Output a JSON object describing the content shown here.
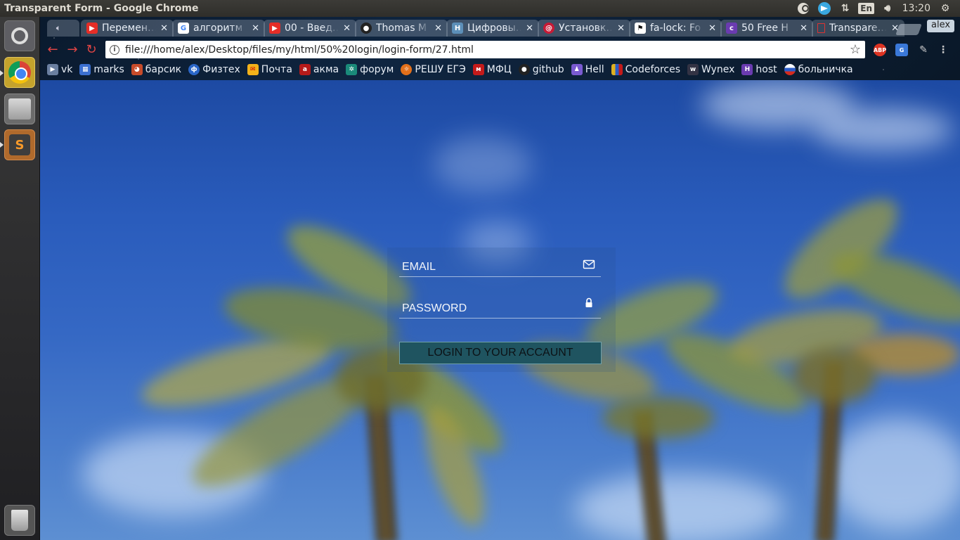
{
  "os": {
    "window_title": "Transparent Form - Google Chrome",
    "keyboard_layout": "En",
    "clock": "13:20"
  },
  "browser": {
    "tabs": [
      {
        "title": "Перемен…",
        "favicon": "youtube-icon",
        "color": "#e52d27"
      },
      {
        "title": "алгоритм",
        "favicon": "google-icon",
        "color": "#ffffff"
      },
      {
        "title": "00 - Введ…",
        "favicon": "youtube-icon",
        "color": "#e52d27"
      },
      {
        "title": "Thomas M",
        "favicon": "github-icon",
        "color": "#222222"
      },
      {
        "title": "Цифровы…",
        "favicon": "h-icon",
        "color": "#5c8fb8"
      },
      {
        "title": "Установк…",
        "favicon": "debian-icon",
        "color": "#c71a36"
      },
      {
        "title": "fa-lock: Fo",
        "favicon": "flag-icon",
        "color": "#111111"
      },
      {
        "title": "50 Free H",
        "favicon": "colorlib-icon",
        "color": "#6a3bb0"
      },
      {
        "title": "Transpare…",
        "favicon": "file-icon",
        "color": "#d33"
      }
    ],
    "profile_name": "alex",
    "url": "file:///home/alex/Desktop/files/my/html/50%20login/login-form/27.html",
    "abp_label": "ABP",
    "bookmarks": [
      {
        "label": "vk",
        "icon": "play-icon",
        "color": "#6a7fa0"
      },
      {
        "label": "marks",
        "icon": "grid-icon",
        "color": "#3b6fd0"
      },
      {
        "label": "барсик",
        "icon": "cat-icon",
        "color": "#c74b2a"
      },
      {
        "label": "Физтех",
        "icon": "mipt-icon",
        "color": "#2a66c8"
      },
      {
        "label": "Почта",
        "icon": "mail-icon",
        "color": "#f3b21a"
      },
      {
        "label": "акма",
        "icon": "akma-icon",
        "color": "#b51a1a"
      },
      {
        "label": "форум",
        "icon": "forum-icon",
        "color": "#1a8a7a"
      },
      {
        "label": "РЕШУ ЕГЭ",
        "icon": "sun-icon",
        "color": "#e3701a"
      },
      {
        "label": "МФЦ",
        "icon": "mfc-icon",
        "color": "#c41a1a"
      },
      {
        "label": "github",
        "icon": "github-icon",
        "color": "#222222"
      },
      {
        "label": "Hell",
        "icon": "person-icon",
        "color": "#7a5ad0"
      },
      {
        "label": "Codeforces",
        "icon": "codeforces-icon",
        "color": "#e0b020"
      },
      {
        "label": "Wynex",
        "icon": "wynex-icon",
        "color": "#333344"
      },
      {
        "label": "host",
        "icon": "host-icon",
        "color": "#6a3bb0"
      },
      {
        "label": "больничка",
        "icon": "russia-flag-icon",
        "color": "#2a5cc8"
      }
    ]
  },
  "form": {
    "email_placeholder": "EMAIL",
    "password_placeholder": "PASSWORD",
    "login_label": "LOGIN TO YOUR ACCAUNT"
  }
}
